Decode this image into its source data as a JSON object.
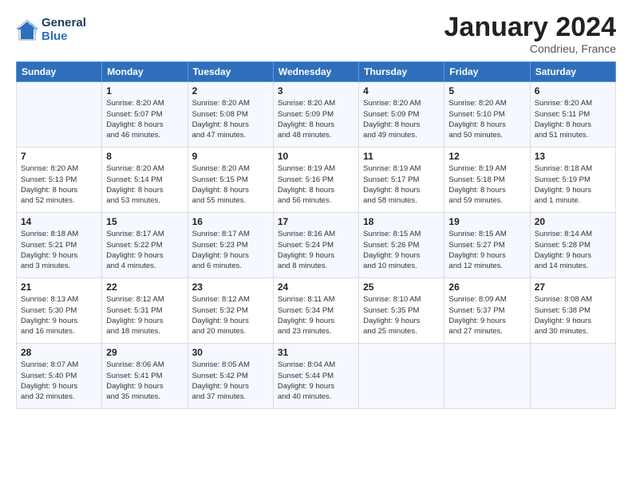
{
  "header": {
    "logo_line1": "General",
    "logo_line2": "Blue",
    "month_year": "January 2024",
    "location": "Condrieu, France"
  },
  "columns": [
    "Sunday",
    "Monday",
    "Tuesday",
    "Wednesday",
    "Thursday",
    "Friday",
    "Saturday"
  ],
  "weeks": [
    [
      {
        "day": "",
        "info": ""
      },
      {
        "day": "1",
        "info": "Sunrise: 8:20 AM\nSunset: 5:07 PM\nDaylight: 8 hours\nand 46 minutes."
      },
      {
        "day": "2",
        "info": "Sunrise: 8:20 AM\nSunset: 5:08 PM\nDaylight: 8 hours\nand 47 minutes."
      },
      {
        "day": "3",
        "info": "Sunrise: 8:20 AM\nSunset: 5:09 PM\nDaylight: 8 hours\nand 48 minutes."
      },
      {
        "day": "4",
        "info": "Sunrise: 8:20 AM\nSunset: 5:09 PM\nDaylight: 8 hours\nand 49 minutes."
      },
      {
        "day": "5",
        "info": "Sunrise: 8:20 AM\nSunset: 5:10 PM\nDaylight: 8 hours\nand 50 minutes."
      },
      {
        "day": "6",
        "info": "Sunrise: 8:20 AM\nSunset: 5:11 PM\nDaylight: 8 hours\nand 51 minutes."
      }
    ],
    [
      {
        "day": "7",
        "info": "Sunrise: 8:20 AM\nSunset: 5:13 PM\nDaylight: 8 hours\nand 52 minutes."
      },
      {
        "day": "8",
        "info": "Sunrise: 8:20 AM\nSunset: 5:14 PM\nDaylight: 8 hours\nand 53 minutes."
      },
      {
        "day": "9",
        "info": "Sunrise: 8:20 AM\nSunset: 5:15 PM\nDaylight: 8 hours\nand 55 minutes."
      },
      {
        "day": "10",
        "info": "Sunrise: 8:19 AM\nSunset: 5:16 PM\nDaylight: 8 hours\nand 56 minutes."
      },
      {
        "day": "11",
        "info": "Sunrise: 8:19 AM\nSunset: 5:17 PM\nDaylight: 8 hours\nand 58 minutes."
      },
      {
        "day": "12",
        "info": "Sunrise: 8:19 AM\nSunset: 5:18 PM\nDaylight: 8 hours\nand 59 minutes."
      },
      {
        "day": "13",
        "info": "Sunrise: 8:18 AM\nSunset: 5:19 PM\nDaylight: 9 hours\nand 1 minute."
      }
    ],
    [
      {
        "day": "14",
        "info": "Sunrise: 8:18 AM\nSunset: 5:21 PM\nDaylight: 9 hours\nand 3 minutes."
      },
      {
        "day": "15",
        "info": "Sunrise: 8:17 AM\nSunset: 5:22 PM\nDaylight: 9 hours\nand 4 minutes."
      },
      {
        "day": "16",
        "info": "Sunrise: 8:17 AM\nSunset: 5:23 PM\nDaylight: 9 hours\nand 6 minutes."
      },
      {
        "day": "17",
        "info": "Sunrise: 8:16 AM\nSunset: 5:24 PM\nDaylight: 9 hours\nand 8 minutes."
      },
      {
        "day": "18",
        "info": "Sunrise: 8:15 AM\nSunset: 5:26 PM\nDaylight: 9 hours\nand 10 minutes."
      },
      {
        "day": "19",
        "info": "Sunrise: 8:15 AM\nSunset: 5:27 PM\nDaylight: 9 hours\nand 12 minutes."
      },
      {
        "day": "20",
        "info": "Sunrise: 8:14 AM\nSunset: 5:28 PM\nDaylight: 9 hours\nand 14 minutes."
      }
    ],
    [
      {
        "day": "21",
        "info": "Sunrise: 8:13 AM\nSunset: 5:30 PM\nDaylight: 9 hours\nand 16 minutes."
      },
      {
        "day": "22",
        "info": "Sunrise: 8:12 AM\nSunset: 5:31 PM\nDaylight: 9 hours\nand 18 minutes."
      },
      {
        "day": "23",
        "info": "Sunrise: 8:12 AM\nSunset: 5:32 PM\nDaylight: 9 hours\nand 20 minutes."
      },
      {
        "day": "24",
        "info": "Sunrise: 8:11 AM\nSunset: 5:34 PM\nDaylight: 9 hours\nand 23 minutes."
      },
      {
        "day": "25",
        "info": "Sunrise: 8:10 AM\nSunset: 5:35 PM\nDaylight: 9 hours\nand 25 minutes."
      },
      {
        "day": "26",
        "info": "Sunrise: 8:09 AM\nSunset: 5:37 PM\nDaylight: 9 hours\nand 27 minutes."
      },
      {
        "day": "27",
        "info": "Sunrise: 8:08 AM\nSunset: 5:38 PM\nDaylight: 9 hours\nand 30 minutes."
      }
    ],
    [
      {
        "day": "28",
        "info": "Sunrise: 8:07 AM\nSunset: 5:40 PM\nDaylight: 9 hours\nand 32 minutes."
      },
      {
        "day": "29",
        "info": "Sunrise: 8:06 AM\nSunset: 5:41 PM\nDaylight: 9 hours\nand 35 minutes."
      },
      {
        "day": "30",
        "info": "Sunrise: 8:05 AM\nSunset: 5:42 PM\nDaylight: 9 hours\nand 37 minutes."
      },
      {
        "day": "31",
        "info": "Sunrise: 8:04 AM\nSunset: 5:44 PM\nDaylight: 9 hours\nand 40 minutes."
      },
      {
        "day": "",
        "info": ""
      },
      {
        "day": "",
        "info": ""
      },
      {
        "day": "",
        "info": ""
      }
    ]
  ]
}
